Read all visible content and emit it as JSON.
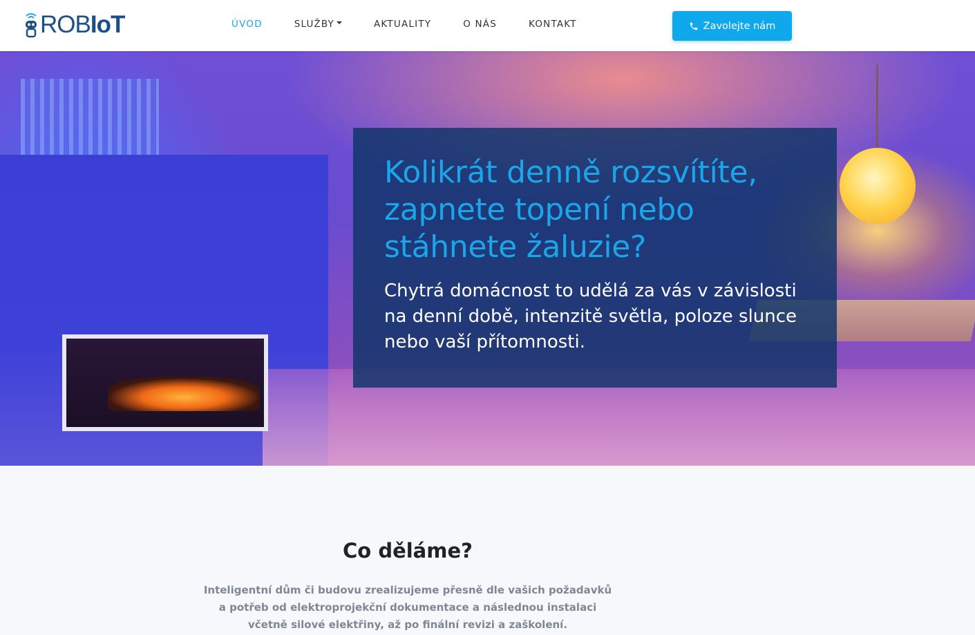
{
  "brand": {
    "rob": "ROB",
    "iot": "IoT",
    "primary_color": "#1d4f86",
    "accent_color": "#1aa6e8"
  },
  "nav": {
    "items": [
      {
        "label": "ÚVOD",
        "active": true
      },
      {
        "label": "SLUŽBY",
        "dropdown": true
      },
      {
        "label": "AKTUALITY"
      },
      {
        "label": "O NÁS"
      },
      {
        "label": "KONTAKT"
      }
    ],
    "cta": {
      "label": "Zavolejte nám",
      "icon": "phone-icon",
      "color": "#0fa8ec"
    }
  },
  "hero": {
    "title": "Kolikrát denně rozsvítíte, zapnete topení nebo stáhnete žaluzie?",
    "subtitle": "Chytrá domácnost to udělá za vás v závislosti na denní době, intenzitě světla, poloze slunce nebo vaší přítomnosti."
  },
  "section": {
    "title": "Co děláme?",
    "text": "Inteligentní dům či budovu zrealizujeme přesně dle vašich požadavků a potřeb od elektroprojekční dokumentace a následnou instalaci včetně silové elektřiny, až po finální revizi a zaškolení."
  }
}
